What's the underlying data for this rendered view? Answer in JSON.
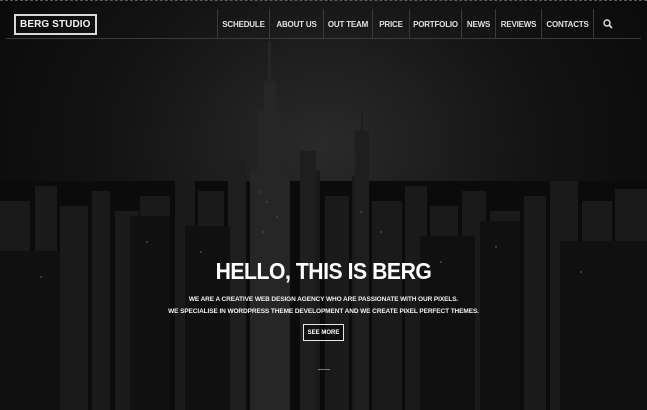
{
  "brand": {
    "logo_text": "BERG STUDIO"
  },
  "nav": {
    "items": [
      {
        "label": "SCHEDULE",
        "name": "nav-schedule"
      },
      {
        "label": "ABOUT US",
        "name": "nav-about-us"
      },
      {
        "label": "OUT TEAM",
        "name": "nav-out-team"
      },
      {
        "label": "PRICE",
        "name": "nav-price"
      },
      {
        "label": "PORTFOLIO",
        "name": "nav-portfolio"
      },
      {
        "label": "NEWS",
        "name": "nav-news"
      },
      {
        "label": "REVIEWS",
        "name": "nav-reviews"
      },
      {
        "label": "CONTACTS",
        "name": "nav-contacts"
      }
    ],
    "search_icon": "search-icon"
  },
  "hero": {
    "title": "HELLO, THIS IS BERG",
    "subtitle_line1": "WE ARE A CREATIVE WEB DESIGN AGENCY WHO ARE PASSIONATE WITH OUR PIXELS.",
    "subtitle_line2": "WE SPECIALISE IN WORDPRESS THEME DEVELOPMENT AND WE CREATE PIXEL PERFECT THEMES.",
    "cta_label": "SEE MORE"
  }
}
